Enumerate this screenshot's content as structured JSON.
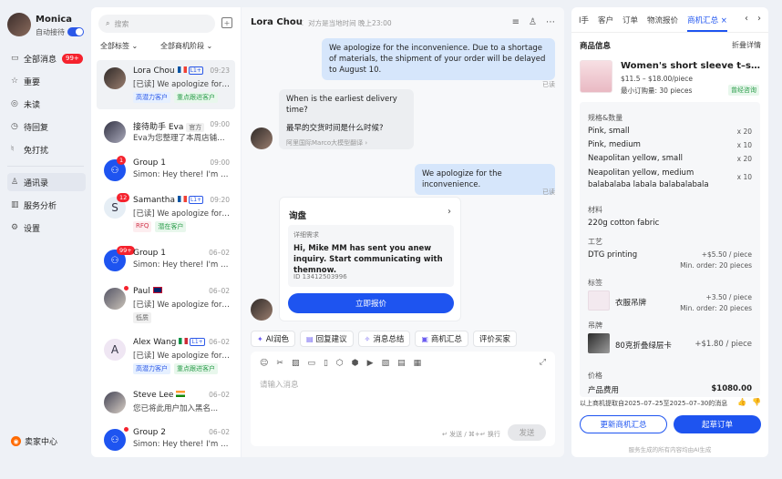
{
  "user": {
    "name": "Monica",
    "status": "自动接待"
  },
  "nav": {
    "items": [
      {
        "label": "全部消息",
        "badge": "99+",
        "icon": "chat-icon"
      },
      {
        "label": "重要",
        "icon": "star-icon"
      },
      {
        "label": "未读",
        "icon": "eye-icon"
      },
      {
        "label": "待回复",
        "icon": "clock-icon"
      },
      {
        "label": "免打扰",
        "icon": "bell-off-icon"
      },
      {
        "label": "通讯录",
        "icon": "contacts-icon"
      },
      {
        "label": "服务分析",
        "icon": "analytics-icon"
      },
      {
        "label": "设置",
        "icon": "gear-icon"
      }
    ],
    "seller_center": "卖家中心"
  },
  "list": {
    "search_placeholder": "搜索",
    "filter_tags": "全部标签",
    "filter_stage": "全部商机阶段",
    "conversations": [
      {
        "name": "Lora Chou",
        "time": "09:23",
        "msg": "[已读] We apologize for t...",
        "tags": [
          "高潜力客户",
          "重点跟进客户"
        ],
        "tagc": [
          "blue",
          "green"
        ],
        "flag": "fr",
        "level": "L1+"
      },
      {
        "name": "接待助手 Eva",
        "sub": "官方",
        "time": "09:00",
        "msg": "Eva为您整理了本周店铺卡...",
        "tags": [],
        "tagc": []
      },
      {
        "name": "Group 1",
        "time": "09:00",
        "msg": "Simon: Hey there! I'm her...",
        "tags": [],
        "tagc": [],
        "badge": "1"
      },
      {
        "name": "Samantha",
        "time": "09:20",
        "msg": "[已读] We apologize for t...",
        "tags": [
          "RFQ",
          "潜在客户"
        ],
        "tagc": [
          "pink",
          "green"
        ],
        "badge": "12",
        "flag": "fr",
        "level": "L1+"
      },
      {
        "name": "Group 1",
        "time": "06–02",
        "msg": "Simon: Hey there! I'm her...",
        "tags": [],
        "tagc": [],
        "badge": "99+"
      },
      {
        "name": "Paul",
        "time": "06–02",
        "msg": "[已读] We apologize for t...",
        "tags": [
          "低质"
        ],
        "tagc": [
          "grey"
        ],
        "flag": "uk",
        "dot": true
      },
      {
        "name": "Alex Wang",
        "time": "06–02",
        "msg": "[已读] We apologize for t...",
        "tags": [
          "高潜力客户",
          "重点跟进客户"
        ],
        "tagc": [
          "blue",
          "green"
        ],
        "flag": "it",
        "level": "L1+"
      },
      {
        "name": "Steve Lee",
        "time": "06–02",
        "msg": "您已将此用户加入黑名...",
        "tags": [],
        "tagc": [],
        "flag": "in"
      },
      {
        "name": "Group 2",
        "time": "06–02",
        "msg": "Simon: Hey there! I'm her...",
        "tags": [],
        "tagc": [],
        "dot": true
      }
    ]
  },
  "chat": {
    "title": "Lora Chou",
    "local_time": "对方是当地时间 晚上23:00",
    "msg1": "We apologize for the inconvenience. Due to a shortage of materials, the shipment of your order will be delayed to August 10.",
    "read": "已读",
    "msg2_en": "When is the earliest delivery time?",
    "msg2_zh": "最早的交货时间是什么时候?",
    "msg2_note": "阿里国际Marco大模型翻译 ›",
    "msg3": "We apologize for the inconvenience.",
    "card": {
      "title": "询盘",
      "label": "详细需求",
      "text": "Hi, Mike MM has sent you anew inquiry. Start communicating with themnow.",
      "id": "ID 13412503996",
      "button": "立即报价"
    },
    "quick": [
      {
        "icon": "ai-polish-icon",
        "label": "AI润色"
      },
      {
        "icon": "reply-suggest-icon",
        "label": "回复建议"
      },
      {
        "icon": "summary-icon",
        "label": "消息总结"
      },
      {
        "icon": "opportunity-icon",
        "label": "商机汇总"
      },
      {
        "icon": "rate-buyer-icon",
        "label": "评价买家"
      }
    ],
    "placeholder": "请输入消息",
    "hint": "↵ 发送 / ⌘+↵ 换行",
    "send": "发送"
  },
  "panel": {
    "tabs": [
      "I手",
      "客户",
      "订单",
      "物流报价",
      "商机汇总"
    ],
    "section": "商品信息",
    "fold": "折叠详情",
    "product": {
      "name": "Women's short sleeve t–shirt pl...",
      "price": "$11.5 – $18.00/piece",
      "moq": "最小订购量: 30 pieces",
      "tag": "曾经咨询"
    },
    "spec_title": "规格&数量",
    "specs": [
      {
        "name": "Pink, small",
        "qty": "x 20"
      },
      {
        "name": "Pink, medium",
        "qty": "x 10"
      },
      {
        "name": "Neapolitan yellow, small",
        "qty": "x 20"
      },
      {
        "name": "Neapolitan yellow, medium balabalaba labala balabalabala",
        "qty": "x 10"
      }
    ],
    "material_title": "材料",
    "material": "220g cotton fabric",
    "craft_title": "工艺",
    "craft": "DTG printing",
    "craft_price": "+$5.50 / piece",
    "craft_min": "Min. order: 20 pieces",
    "label_title": "标签",
    "label_name": "衣服吊牌",
    "label_price": "+3.50 / piece",
    "label_min": "Min. order: 20 pieces",
    "tag_title": "吊牌",
    "tag_name": "80克折叠绿层卡",
    "tag_price": "+$1.80 / piece",
    "price_title": "价格",
    "price_row": "产品费用",
    "price_val": "$1080.00",
    "disclaimer": "以上商机提取自2025–07–25至2025–07–30的消息",
    "btn_update": "更新商机汇总",
    "btn_order": "起草订单",
    "footer": "服务生成的所有内容均由AI生成"
  }
}
